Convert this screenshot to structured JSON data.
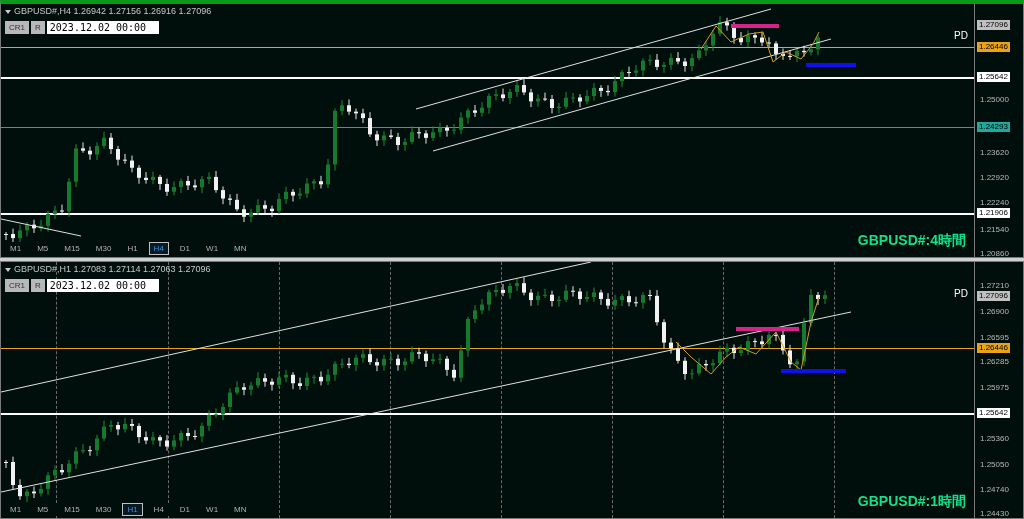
{
  "panels": [
    {
      "active": true,
      "header": "GBPUSD#,H4  1.26942 1.27156 1.26916 1.27096",
      "buttons": [
        "CR1",
        "R"
      ],
      "date": "2023.12.02 00:00",
      "marker": "PD",
      "title": "GBPUSD#:4時間",
      "ticks": [
        "1.25000",
        "1.23620",
        "1.22920",
        "1.22240",
        "1.21540",
        "1.20860"
      ],
      "price_tags": [
        {
          "text": "1.27096",
          "kind": "price",
          "color": "#c0c0c0"
        },
        {
          "text": "1.26446",
          "kind": "level",
          "color": "#e8a317"
        },
        {
          "text": "1.25642",
          "kind": "level",
          "color": "#ffffff"
        },
        {
          "text": "1.24293",
          "kind": "level",
          "color": "#1fa89c"
        },
        {
          "text": "1.21906",
          "kind": "level",
          "color": "#ffffff"
        }
      ],
      "timeframes": [
        {
          "label": "M1",
          "selected": false
        },
        {
          "label": "M5",
          "selected": false
        },
        {
          "label": "M15",
          "selected": false
        },
        {
          "label": "M30",
          "selected": false
        },
        {
          "label": "H1",
          "selected": false
        },
        {
          "label": "H4",
          "selected": true
        },
        {
          "label": "D1",
          "selected": false
        },
        {
          "label": "W1",
          "selected": false
        },
        {
          "label": "MN",
          "selected": false
        }
      ]
    },
    {
      "active": false,
      "header": "GBPUSD#,H1  1.27083 1.27114 1.27063 1.27096",
      "buttons": [
        "CR1",
        "R"
      ],
      "date": "2023.12.02 00:00",
      "marker": "PD",
      "title": "GBPUSD#:1時間",
      "ticks": [
        "1.27210",
        "1.26900",
        "1.26595",
        "1.26285",
        "1.25975",
        "1.25360",
        "1.25050",
        "1.24740",
        "1.24430"
      ],
      "price_tags": [
        {
          "text": "1.27096",
          "kind": "price",
          "color": "#c0c0c0"
        },
        {
          "text": "1.26446",
          "kind": "level",
          "color": "#e8a317"
        },
        {
          "text": "1.25642",
          "kind": "level",
          "color": "#ffffff"
        }
      ],
      "timeframes": [
        {
          "label": "M1",
          "selected": false
        },
        {
          "label": "M5",
          "selected": false
        },
        {
          "label": "M15",
          "selected": false
        },
        {
          "label": "M30",
          "selected": false
        },
        {
          "label": "H1",
          "selected": true
        },
        {
          "label": "H4",
          "selected": false
        },
        {
          "label": "D1",
          "selected": false
        },
        {
          "label": "W1",
          "selected": false
        },
        {
          "label": "MN",
          "selected": false
        }
      ]
    }
  ]
}
